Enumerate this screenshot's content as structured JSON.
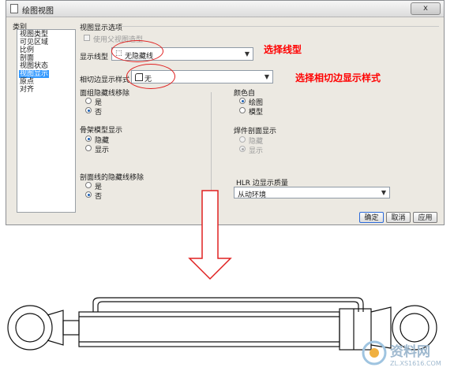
{
  "window": {
    "title": "绘图视图",
    "close_label": "x"
  },
  "category": {
    "label": "类别",
    "items": [
      "视图类型",
      "可见区域",
      "比例",
      "剖面",
      "视图状态",
      "视图显示",
      "原点",
      "对齐"
    ],
    "selected_index": 5
  },
  "display_options": {
    "group_title": "视图显示选项",
    "use_parent_label": "使用父视图造型",
    "line_style_label": "显示线型",
    "line_style_value": "无隐藏线",
    "tangent_label": "相切边显示样式",
    "tangent_value": "无"
  },
  "annotations": {
    "select_line_style": "选择线型",
    "select_tangent_style": "选择相切边显示样式"
  },
  "hidden_line_removal": {
    "title": "面组隐藏线移除",
    "options": [
      "是",
      "否"
    ],
    "selected": "否"
  },
  "skeleton_display": {
    "title": "骨架模型显示",
    "options": [
      "隐藏",
      "显示"
    ],
    "selected": "隐藏"
  },
  "section_hidden_removal": {
    "title": "剖面线的隐藏线移除",
    "options": [
      "是",
      "否"
    ],
    "selected": "否"
  },
  "color_from": {
    "title": "颜色自",
    "options": [
      "绘图",
      "模型"
    ],
    "selected": "绘图"
  },
  "weld_section": {
    "title": "焊件剖面显示",
    "options": [
      "隐藏",
      "显示"
    ],
    "selected": "显示"
  },
  "hlr_quality": {
    "title": "HLR 边显示质量",
    "value": "从动环境"
  },
  "buttons": {
    "ok": "确定",
    "cancel": "取消",
    "apply": "应用"
  },
  "watermark": {
    "brand": "资料网",
    "url": "ZL.XS1616.COM"
  },
  "colors": {
    "accent": "#3399ff",
    "annotation": "#ff0000",
    "arrow": "#e02020"
  }
}
